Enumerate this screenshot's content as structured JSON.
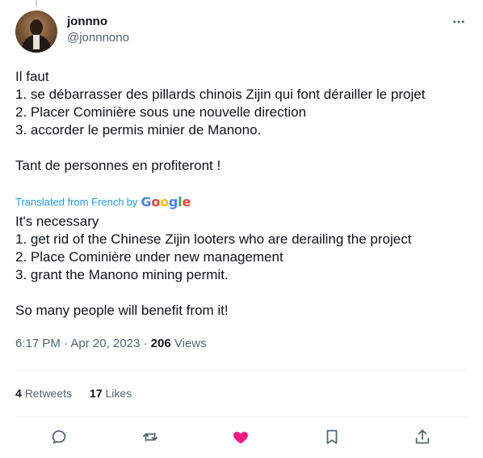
{
  "author": {
    "display_name": "jonnno",
    "handle": "@jonnnono"
  },
  "tweet": {
    "original_lines": [
      "Il faut",
      "1. se débarrasser des pillards chinois Zijin qui font dérailler le projet",
      "2. Placer Cominière sous une nouvelle direction",
      "3. accorder le permis minier de Manono.",
      "Tant de personnes en profiteront !"
    ],
    "translated_from": "Translated from French",
    "translated_by": "by",
    "translator_brand": "Google",
    "translated_lines": [
      "It's necessary",
      "1. get rid of the Chinese Zijin looters who are derailing the project",
      "2. Place Cominière under new management",
      "3. grant the Manono mining permit.",
      "So many people will benefit from it!"
    ]
  },
  "meta": {
    "time": "6:17 PM",
    "separator": "·",
    "date": "Apr 20, 2023",
    "views_count": "206",
    "views_label": "Views"
  },
  "stats": {
    "retweets_count": "4",
    "retweets_label": "Retweets",
    "likes_count": "17",
    "likes_label": "Likes"
  },
  "icons": {
    "more": "more-horizontal-icon",
    "reply": "reply-icon",
    "retweet": "retweet-icon",
    "like": "heart-filled-icon",
    "bookmark": "bookmark-icon",
    "share": "share-icon"
  },
  "colors": {
    "text": "#0f1419",
    "secondary_text": "#536471",
    "link": "#1d9bf0",
    "like_active": "#f91880",
    "divider": "#eff3f4"
  }
}
